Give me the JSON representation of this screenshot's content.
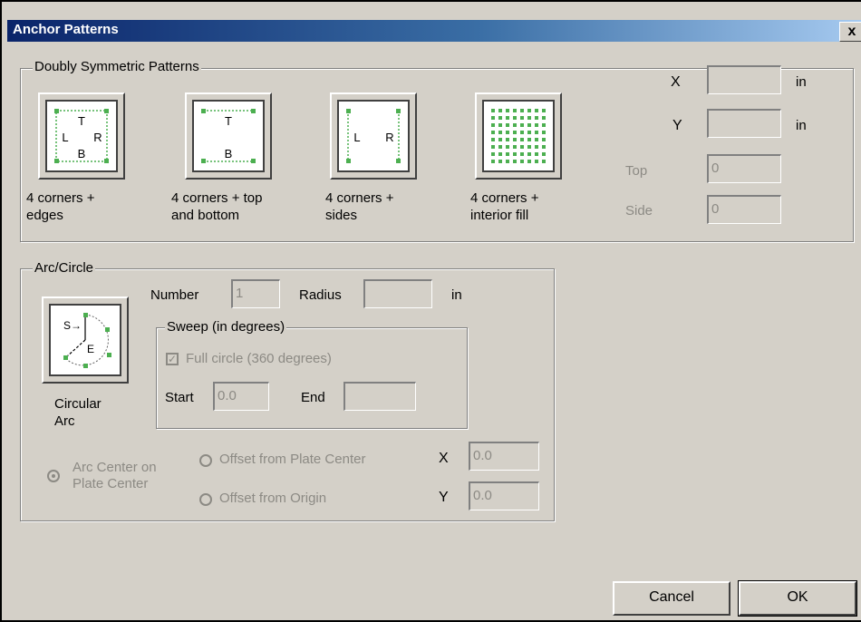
{
  "window": {
    "title": "Anchor Patterns",
    "close_glyph": "x"
  },
  "doubly": {
    "legend": "Doubly Symmetric Patterns",
    "patterns": [
      {
        "line1": "4 corners +",
        "line2": "edges",
        "icon": "corners-edges-icon",
        "letters": {
          "top": "T",
          "left": "L",
          "right": "R",
          "bottom": "B"
        }
      },
      {
        "line1": "4 corners + top",
        "line2": "and bottom",
        "icon": "corners-top-bottom-icon",
        "letters": {
          "top": "T",
          "bottom": "B"
        }
      },
      {
        "line1": "4 corners +",
        "line2": "sides",
        "icon": "corners-sides-icon",
        "letters": {
          "left": "L",
          "right": "R"
        }
      },
      {
        "line1": "4 corners +",
        "line2": "interior fill",
        "icon": "interior-fill-icon"
      }
    ],
    "x_label": "X",
    "x_value": "",
    "x_unit": "in",
    "y_label": "Y",
    "y_value": "",
    "y_unit": "in",
    "top_label": "Top",
    "top_value": "0",
    "side_label": "Side",
    "side_value": "0"
  },
  "arc": {
    "legend": "Arc/Circle",
    "number_label": "Number",
    "number_value": "1",
    "radius_label": "Radius",
    "radius_value": "",
    "radius_unit": "in",
    "sweep_legend": "Sweep (in degrees)",
    "full_circle_label": "Full circle (360 degrees)",
    "full_circle_checked": true,
    "start_label": "Start",
    "start_value": "0.0",
    "end_label": "End",
    "end_value": "",
    "icon_label_line1": "Circular",
    "icon_label_line2": "Arc",
    "icon_letters": {
      "start": "S",
      "end": "E"
    },
    "radio_center_line1": "Arc Center on",
    "radio_center_line2": "Plate Center",
    "radio_offset_plate": "Offset from Plate Center",
    "radio_offset_origin": "Offset from Origin",
    "x_label": "X",
    "x_value": "0.0",
    "y_label": "Y",
    "y_value": "0.0"
  },
  "buttons": {
    "cancel": "Cancel",
    "ok": "OK"
  },
  "colors": {
    "anchor_green": "#4caf50",
    "title_start": "#0a246a",
    "title_end": "#a6caf0",
    "face": "#d4d0c8"
  }
}
